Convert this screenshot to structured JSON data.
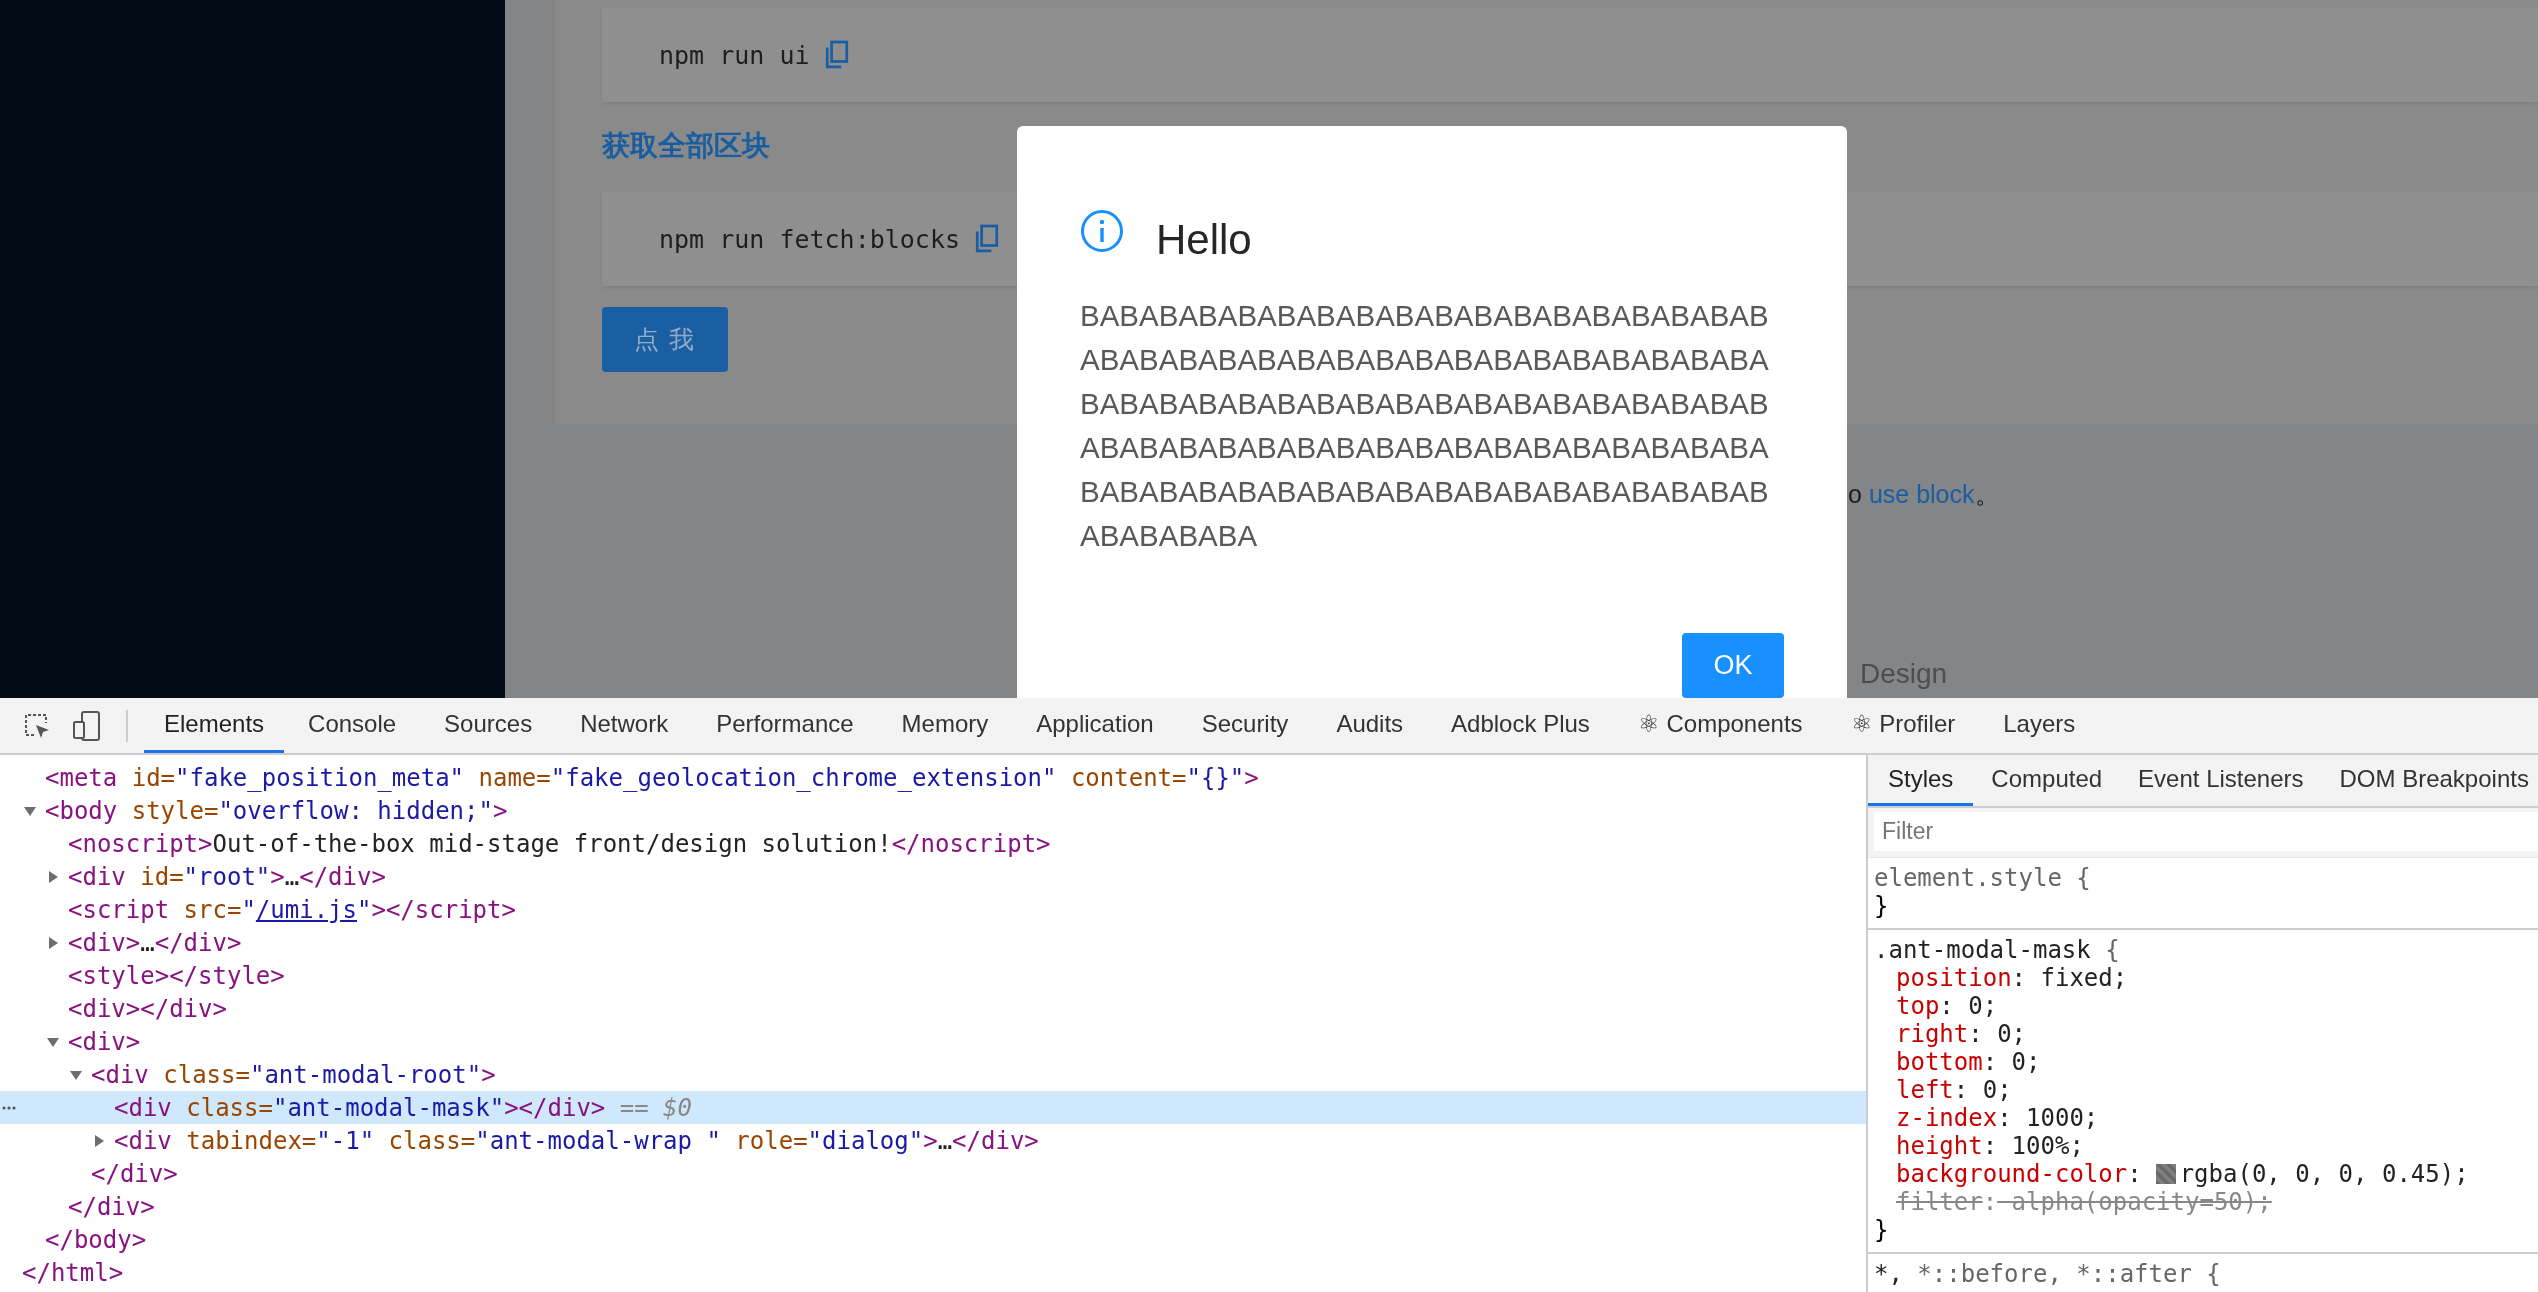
{
  "page": {
    "sections": [
      {
        "kind": "code",
        "command": "npm run ui"
      },
      {
        "kind": "heading",
        "text": "获取全部区块"
      },
      {
        "kind": "code",
        "command": "npm run fetch:blocks"
      },
      {
        "kind": "button",
        "label": "点 我"
      }
    ],
    "note": {
      "text": "o",
      "link": "use block",
      "end": "。"
    },
    "footer": "Design"
  },
  "modal": {
    "title": "Hello",
    "content": "BABABABABABABABABABABABABABABABABABABABABABABABABABABABABABABABABABABABABABABABABABABABABABABABABABABABABABABABABABABABABABABABABABABABABABABABABABABABABABABABABABABABABABABABABABABABA",
    "ok_button": "OK"
  },
  "devtools": {
    "tabs": [
      {
        "label": "Elements",
        "selected": true
      },
      {
        "label": "Console",
        "selected": false
      },
      {
        "label": "Sources",
        "selected": false
      },
      {
        "label": "Network",
        "selected": false
      },
      {
        "label": "Performance",
        "selected": false
      },
      {
        "label": "Memory",
        "selected": false
      },
      {
        "label": "Application",
        "selected": false
      },
      {
        "label": "Security",
        "selected": false
      },
      {
        "label": "Audits",
        "selected": false
      },
      {
        "label": "Adblock Plus",
        "selected": false
      },
      {
        "label": "⚛ Components",
        "selected": false
      },
      {
        "label": "⚛ Profiler",
        "selected": false
      },
      {
        "label": "Layers",
        "selected": false
      }
    ],
    "elements": {
      "nodes": [
        {
          "selected": false,
          "segments": [
            {
              "kind": "tag",
              "text": "<meta"
            },
            {
              "kind": "attr",
              "text": " id="
            },
            {
              "kind": "value",
              "text": "\"fake_position_meta\""
            },
            {
              "kind": "attr",
              "text": " name="
            },
            {
              "kind": "value",
              "text": "\"fake_geolocation_chrome_extension\""
            },
            {
              "kind": "attr",
              "text": " content="
            },
            {
              "kind": "value",
              "text": "\"{}\""
            },
            {
              "kind": "tag",
              "text": ">"
            }
          ]
        },
        {
          "selected": false,
          "expanded": true,
          "segments": [
            {
              "kind": "tag",
              "text": "<body"
            },
            {
              "kind": "attr",
              "text": " style="
            },
            {
              "kind": "value",
              "text": "\"overflow: hidden;\""
            },
            {
              "kind": "tag",
              "text": ">"
            }
          ],
          "closing": [
            {
              "kind": "tag",
              "text": "</body>"
            }
          ],
          "children": [
            {
              "selected": false,
              "segments": [
                {
                  "kind": "tag",
                  "text": "<noscript>"
                },
                {
                  "kind": "text",
                  "text": "Out-of-the-box mid-stage front/design solution!"
                },
                {
                  "kind": "tag",
                  "text": "</noscript>"
                }
              ]
            },
            {
              "selected": false,
              "expanded": false,
              "segments": [
                {
                  "kind": "tag",
                  "text": "<div"
                },
                {
                  "kind": "attr",
                  "text": " id="
                },
                {
                  "kind": "value",
                  "text": "\"root\""
                },
                {
                  "kind": "tag",
                  "text": ">"
                },
                {
                  "kind": "text",
                  "text": "…"
                },
                {
                  "kind": "tag",
                  "text": "</div>"
                }
              ]
            },
            {
              "selected": false,
              "segments": [
                {
                  "kind": "tag",
                  "text": "<script"
                },
                {
                  "kind": "attr",
                  "text": " src="
                },
                {
                  "kind": "value",
                  "text": "\""
                },
                {
                  "kind": "link",
                  "text": "/umi.js"
                },
                {
                  "kind": "value",
                  "text": "\""
                },
                {
                  "kind": "tag",
                  "text": "></script>"
                }
              ]
            },
            {
              "selected": false,
              "expanded": false,
              "segments": [
                {
                  "kind": "tag",
                  "text": "<div>"
                },
                {
                  "kind": "text",
                  "text": "…"
                },
                {
                  "kind": "tag",
                  "text": "</div>"
                }
              ]
            },
            {
              "selected": false,
              "segments": [
                {
                  "kind": "tag",
                  "text": "<style></style>"
                }
              ]
            },
            {
              "selected": false,
              "segments": [
                {
                  "kind": "tag",
                  "text": "<div></div>"
                }
              ]
            },
            {
              "selected": false,
              "expanded": true,
              "segments": [
                {
                  "kind": "tag",
                  "text": "<div>"
                }
              ],
              "closing": [
                {
                  "kind": "tag",
                  "text": "</div>"
                }
              ],
              "children": [
                {
                  "selected": false,
                  "expanded": true,
                  "segments": [
                    {
                      "kind": "tag",
                      "text": "<div"
                    },
                    {
                      "kind": "attr",
                      "text": " class="
                    },
                    {
                      "kind": "value",
                      "text": "\"ant-modal-root\""
                    },
                    {
                      "kind": "tag",
                      "text": ">"
                    }
                  ],
                  "closing": [
                    {
                      "kind": "tag",
                      "text": "</div>"
                    }
                  ],
                  "children": [
                    {
                      "selected": true,
                      "segments": [
                        {
                          "kind": "tag",
                          "text": "<div"
                        },
                        {
                          "kind": "attr",
                          "text": " class="
                        },
                        {
                          "kind": "value",
                          "text": "\"ant-modal-mask\""
                        },
                        {
                          "kind": "tag",
                          "text": "></div>"
                        },
                        {
                          "kind": "ref",
                          "text": " == *$0*"
                        }
                      ]
                    },
                    {
                      "selected": false,
                      "expanded": false,
                      "segments": [
                        {
                          "kind": "tag",
                          "text": "<div"
                        },
                        {
                          "kind": "attr",
                          "text": " tabindex="
                        },
                        {
                          "kind": "value",
                          "text": "\"-1\""
                        },
                        {
                          "kind": "attr",
                          "text": " class="
                        },
                        {
                          "kind": "value",
                          "text": "\"ant-modal-wrap \""
                        },
                        {
                          "kind": "attr",
                          "text": " role="
                        },
                        {
                          "kind": "value",
                          "text": "\"dialog\""
                        },
                        {
                          "kind": "tag",
                          "text": ">"
                        },
                        {
                          "kind": "text",
                          "text": "…"
                        },
                        {
                          "kind": "tag",
                          "text": "</div>"
                        }
                      ]
                    }
                  ]
                }
              ]
            }
          ]
        }
      ],
      "tail": [
        {
          "kind": "tag",
          "text": "</html>"
        }
      ]
    },
    "styles": {
      "tabs": [
        {
          "label": "Styles",
          "selected": true
        },
        {
          "label": "Computed",
          "selected": false
        },
        {
          "label": "Event Listeners",
          "selected": false
        },
        {
          "label": "DOM Breakpoints",
          "selected": false
        }
      ],
      "filter": {
        "placeholder": "Filter"
      },
      "rules": [
        {
          "selector": [
            {
              "text": "element.style",
              "matched": false
            },
            {
              "text": " {",
              "matched": false
            }
          ],
          "close": "}"
        },
        {
          "selector": [
            {
              "text": ".ant-modal-mask",
              "matched": true
            },
            {
              "text": " {",
              "matched": false
            }
          ],
          "close": "}",
          "declarations": [
            {
              "property": "position",
              "separator": ":",
              "value": " fixed;",
              "overridden": false
            },
            {
              "property": "top",
              "separator": ":",
              "value": " 0;",
              "overridden": false
            },
            {
              "property": "right",
              "separator": ":",
              "value": " 0;",
              "overridden": false
            },
            {
              "property": "bottom",
              "separator": ":",
              "value": " 0;",
              "overridden": false
            },
            {
              "property": "left",
              "separator": ":",
              "value": " 0;",
              "overridden": false
            },
            {
              "property": "z-index",
              "separator": ":",
              "value": " 1000;",
              "overridden": false
            },
            {
              "property": "height",
              "separator": ":",
              "value": " 100%;",
              "overridden": false
            },
            {
              "property": "background-color",
              "separator": ":",
              "kind": "color",
              "value": "rgba(0, 0, 0, 0.45);",
              "overridden": false
            },
            {
              "property": "filter",
              "separator": ":",
              "value": " alpha(opacity=50);",
              "overridden": true
            }
          ]
        },
        {
          "selector": [
            {
              "text": "*,",
              "matched": true
            },
            {
              "text": " *::before, *::after {",
              "matched": false
            }
          ]
        }
      ]
    }
  }
}
